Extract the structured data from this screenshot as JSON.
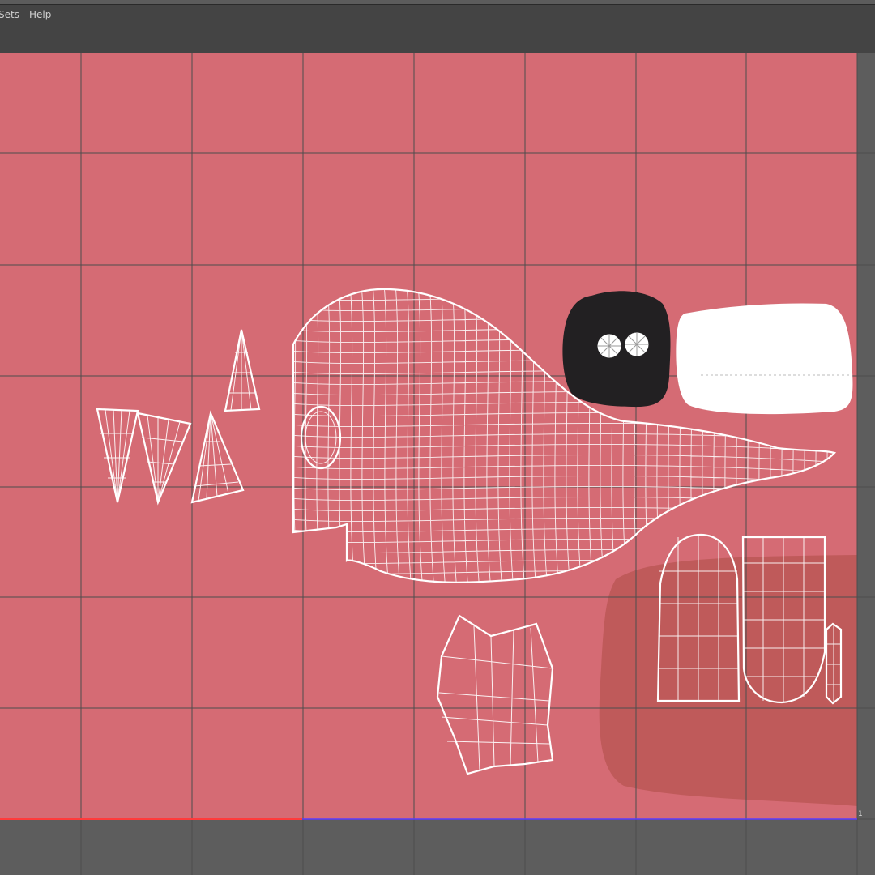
{
  "menubar": {
    "items": [
      {
        "label": "Sets"
      },
      {
        "label": "Help"
      }
    ]
  },
  "uv_editor": {
    "texture_color": "#d56b74",
    "shadow_color": "#bf5a5a",
    "grid_color": "#4d4d4d",
    "wire_color": "#ffffff",
    "viewport_bg": "#5d5d5d",
    "axis_u_color": "#ff3b3b",
    "axis_v_color": "#5b3bff",
    "corner_label": "1"
  }
}
